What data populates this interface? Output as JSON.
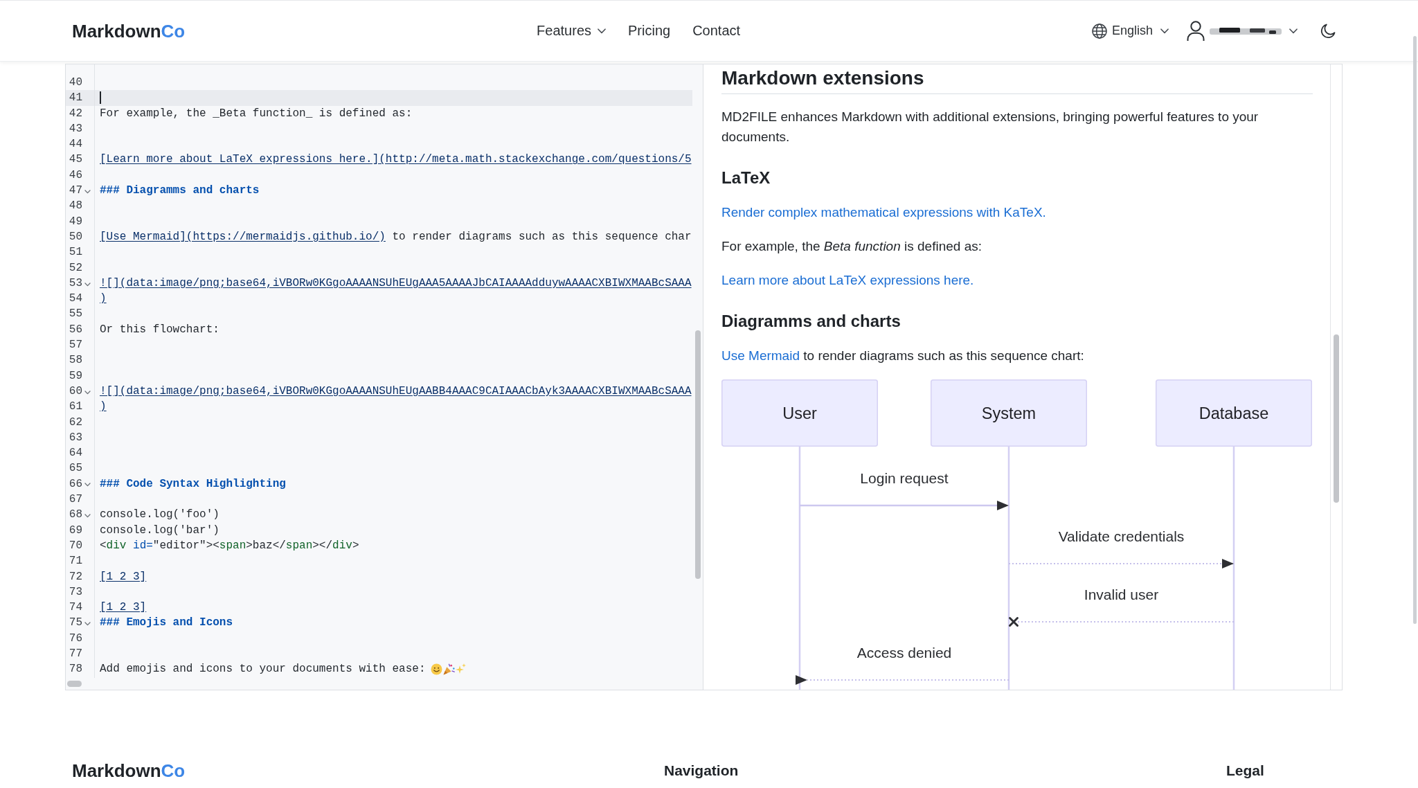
{
  "header": {
    "logo": {
      "text": "Markdown",
      "accent": "Co"
    },
    "nav": [
      {
        "label": "Features",
        "dropdown": true
      },
      {
        "label": "Pricing",
        "dropdown": false
      },
      {
        "label": "Contact",
        "dropdown": false
      }
    ],
    "language": {
      "label": "English",
      "dropdown": true
    },
    "account": {
      "name_hidden": true,
      "dropdown": true
    }
  },
  "editor": {
    "lines": [
      {
        "number": "40",
        "active": false,
        "foldable": false
      },
      {
        "number": "41",
        "active": true,
        "foldable": false
      },
      {
        "number": "42",
        "active": false,
        "foldable": false,
        "segments": [
          {
            "kind": "text",
            "text": "For example, the _Beta function_ is defined as:"
          }
        ]
      },
      {
        "number": "43",
        "active": false,
        "foldable": false
      },
      {
        "number": "44",
        "active": false,
        "foldable": false
      },
      {
        "number": "45",
        "active": false,
        "foldable": false,
        "segments": [
          {
            "kind": "link",
            "text": "[Learn more about LaTeX expressions here.](http://meta.math.stackexchange.com/questions/5"
          }
        ]
      },
      {
        "number": "46",
        "active": false,
        "foldable": false
      },
      {
        "number": "47",
        "active": false,
        "foldable": true,
        "segments": [
          {
            "kind": "heading",
            "text": "### Diagramms and charts"
          }
        ]
      },
      {
        "number": "48",
        "active": false,
        "foldable": false
      },
      {
        "number": "49",
        "active": false,
        "foldable": false
      },
      {
        "number": "50",
        "active": false,
        "foldable": false,
        "segments": [
          {
            "kind": "link",
            "text": "[Use Mermaid](https://mermaidjs.github.io/)"
          },
          {
            "kind": "text",
            "text": " to render diagrams such as this sequence char"
          }
        ]
      },
      {
        "number": "51",
        "active": false,
        "foldable": false
      },
      {
        "number": "52",
        "active": false,
        "foldable": false
      },
      {
        "number": "53",
        "active": false,
        "foldable": true,
        "segments": [
          {
            "kind": "link",
            "text": "![](data:image/png;base64,iVBORw0KGgoAAAANSUhEUgAAA5AAAAJbCAIAAAAdduywAAAACXBIWXMAABcSAAA"
          }
        ]
      },
      {
        "number": "54",
        "active": false,
        "foldable": false,
        "segments": [
          {
            "kind": "link",
            "text": ")"
          }
        ]
      },
      {
        "number": "55",
        "active": false,
        "foldable": false
      },
      {
        "number": "56",
        "active": false,
        "foldable": false,
        "segments": [
          {
            "kind": "text",
            "text": "Or this flowchart:"
          }
        ]
      },
      {
        "number": "57",
        "active": false,
        "foldable": false
      },
      {
        "number": "58",
        "active": false,
        "foldable": false
      },
      {
        "number": "59",
        "active": false,
        "foldable": false
      },
      {
        "number": "60",
        "active": false,
        "foldable": true,
        "segments": [
          {
            "kind": "link",
            "text": "![](data:image/png;base64,iVBORw0KGgoAAAANSUhEUgAABB4AAAC9CAIAAACbAyk3AAAACXBIWXMAABcSAAA"
          }
        ]
      },
      {
        "number": "61",
        "active": false,
        "foldable": false,
        "segments": [
          {
            "kind": "link",
            "text": ")"
          }
        ]
      },
      {
        "number": "62",
        "active": false,
        "foldable": false
      },
      {
        "number": "63",
        "active": false,
        "foldable": false
      },
      {
        "number": "64",
        "active": false,
        "foldable": false
      },
      {
        "number": "65",
        "active": false,
        "foldable": false
      },
      {
        "number": "66",
        "active": false,
        "foldable": true,
        "segments": [
          {
            "kind": "heading",
            "text": "### Code Syntax Highlighting"
          }
        ]
      },
      {
        "number": "67",
        "active": false,
        "foldable": false
      },
      {
        "number": "68",
        "active": false,
        "foldable": true,
        "segments": [
          {
            "kind": "text",
            "text": "console.log('foo')"
          }
        ]
      },
      {
        "number": "69",
        "active": false,
        "foldable": false,
        "segments": [
          {
            "kind": "text",
            "text": "console.log('bar')"
          }
        ]
      },
      {
        "number": "70",
        "active": false,
        "foldable": false,
        "segments": [
          {
            "kind": "text",
            "text": "<"
          },
          {
            "kind": "tag",
            "text": "div"
          },
          {
            "kind": "attr",
            "text": " id="
          },
          {
            "kind": "text",
            "text": "\"editor\"><"
          },
          {
            "kind": "tag",
            "text": "span"
          },
          {
            "kind": "text",
            "text": ">baz</"
          },
          {
            "kind": "tag",
            "text": "span"
          },
          {
            "kind": "text",
            "text": "></"
          },
          {
            "kind": "tag",
            "text": "div"
          },
          {
            "kind": "text",
            "text": ">"
          }
        ]
      },
      {
        "number": "71",
        "active": false,
        "foldable": false
      },
      {
        "number": "72",
        "active": false,
        "foldable": false,
        "segments": [
          {
            "kind": "link",
            "text": "[1 2 3]"
          }
        ]
      },
      {
        "number": "73",
        "active": false,
        "foldable": false
      },
      {
        "number": "74",
        "active": false,
        "foldable": false,
        "segments": [
          {
            "kind": "link",
            "text": "[1 2 3]"
          }
        ]
      },
      {
        "number": "75",
        "active": false,
        "foldable": true,
        "segments": [
          {
            "kind": "heading",
            "text": "### Emojis and Icons"
          }
        ]
      },
      {
        "number": "76",
        "active": false,
        "foldable": false
      },
      {
        "number": "77",
        "active": false,
        "foldable": false
      },
      {
        "number": "78",
        "active": false,
        "foldable": false,
        "segments": [
          {
            "kind": "text",
            "text": "Add emojis and icons to your documents with ease:"
          },
          {
            "kind": "emojis"
          }
        ]
      }
    ]
  },
  "preview": {
    "heading": "Markdown extensions",
    "intro": "MD2FILE enhances Markdown with additional extensions, bringing powerful features to your documents.",
    "sections": [
      {
        "title": "LaTeX",
        "blocks": [
          {
            "kind": "link",
            "text": "Render complex mathematical expressions with KaTeX."
          },
          {
            "kind": "paragraph",
            "text": "For example, the *Beta function* is defined as:"
          },
          {
            "kind": "link",
            "text": "Learn more about LaTeX expressions here."
          }
        ]
      },
      {
        "title": "Diagramms and charts",
        "blocks": [
          {
            "kind": "link_paragraph",
            "link": "Use Mermaid",
            "text": " to render diagrams such as this sequence chart:"
          },
          {
            "kind": "sequence_diagram",
            "participants": [
              {
                "label": "User"
              },
              {
                "label": "System"
              },
              {
                "label": "Database"
              }
            ],
            "messages": [
              {
                "text": "Login request",
                "kind": "solid",
                "from_middle": false,
                "rightward": true
              },
              {
                "text": "Validate credentials",
                "kind": "dotted",
                "from_middle": true,
                "rightward": true
              },
              {
                "text": "Invalid user",
                "kind": "cross",
                "from_middle": false,
                "rightward": false
              },
              {
                "text": "Access denied",
                "kind": "dotted",
                "from_middle": true,
                "rightward": false
              }
            ]
          }
        ]
      }
    ]
  },
  "footer": {
    "logo": {
      "text": "Markdown",
      "accent": "Co"
    },
    "columns": [
      {
        "title": "Navigation"
      },
      {
        "title": "Legal"
      }
    ]
  }
}
